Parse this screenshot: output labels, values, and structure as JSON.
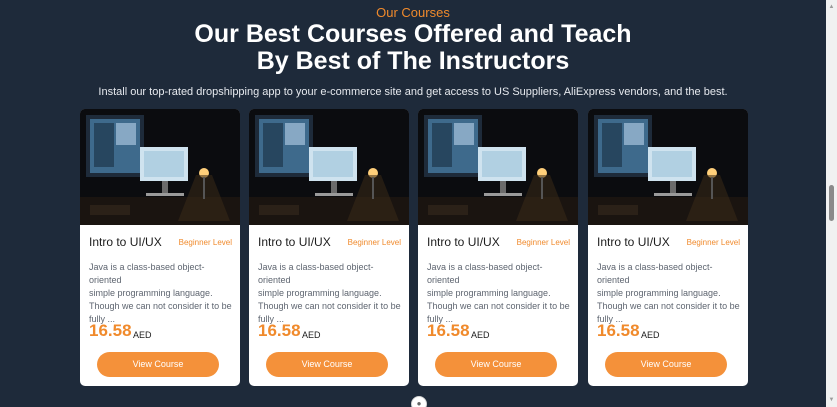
{
  "section": {
    "eyebrow": "Our Courses",
    "headline_line1": "Our Best Courses Offered and Teach",
    "headline_line2": "By Best of The Instructors",
    "subtext": "Install our top-rated dropshipping app to your e-commerce site and get access to US Suppliers, AliExpress vendors, and the best."
  },
  "courses": [
    {
      "title": "Intro to UI/UX",
      "level": "Beginner Level",
      "desc_line1": "Java is a class-based object-oriented",
      "desc_line2": "simple programming language.",
      "desc_line3": "Though we can not consider it to be",
      "desc_line4": "fully ...",
      "price": "16.58",
      "currency": "AED",
      "button": "View Course",
      "image": "desk-computer-photo"
    },
    {
      "title": "Intro to UI/UX",
      "level": "Beginner Level",
      "desc_line1": "Java is a class-based object-oriented",
      "desc_line2": "simple programming language.",
      "desc_line3": "Though we can not consider it to be",
      "desc_line4": "fully ...",
      "price": "16.58",
      "currency": "AED",
      "button": "View Course",
      "image": "desk-computer-photo"
    },
    {
      "title": "Intro to UI/UX",
      "level": "Beginner Level",
      "desc_line1": "Java is a class-based object-oriented",
      "desc_line2": "simple programming language.",
      "desc_line3": "Though we can not consider it to be",
      "desc_line4": "fully ...",
      "price": "16.58",
      "currency": "AED",
      "button": "View Course",
      "image": "desk-computer-photo"
    },
    {
      "title": "Intro to UI/UX",
      "level": "Beginner Level",
      "desc_line1": "Java is a class-based object-oriented",
      "desc_line2": "simple programming language.",
      "desc_line3": "Though we can not consider it to be",
      "desc_line4": "fully ...",
      "price": "16.58",
      "currency": "AED",
      "button": "View Course",
      "image": "desk-computer-photo"
    }
  ],
  "colors": {
    "background": "#1e2a3a",
    "accent": "#f08a2c",
    "button": "#f4913a"
  }
}
